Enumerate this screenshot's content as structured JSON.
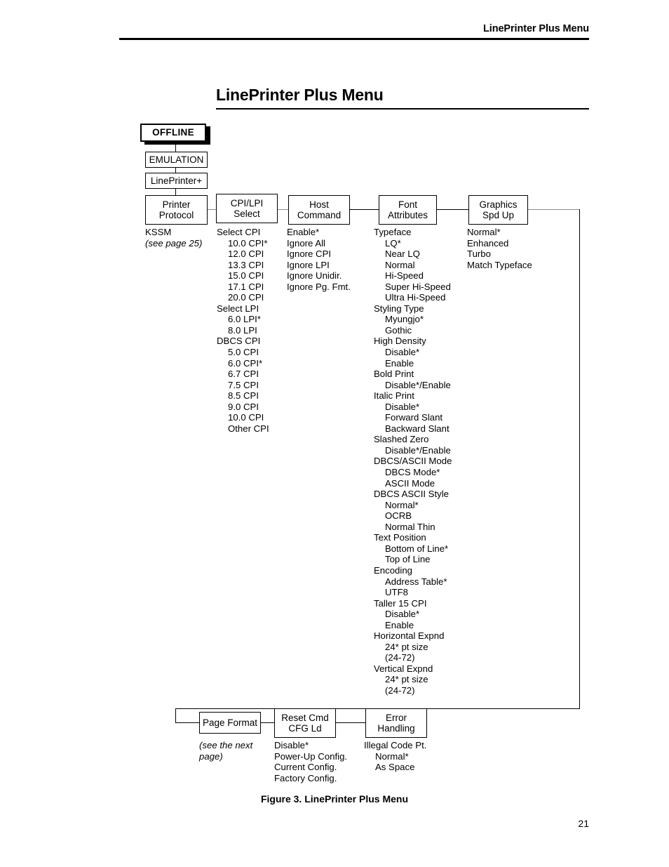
{
  "header": {
    "running_title": "LinePrinter Plus Menu"
  },
  "title": "LinePrinter Plus Menu",
  "caption": "Figure 3. LinePrinter Plus Menu",
  "page_number": "21",
  "diagram": {
    "offline_box": "OFFLINE",
    "emulation_box": "EMULATION",
    "lineprinter_box": "LinePrinter+",
    "columns": [
      {
        "box_line1": "Printer",
        "box_line2": "Protocol",
        "options": [
          {
            "text": "KSSM",
            "level": 0,
            "style": "normal"
          },
          {
            "text": "(see page 25)",
            "level": 0,
            "style": "italic"
          }
        ]
      },
      {
        "box_line1": "CPI/LPI Select",
        "box_line2": "",
        "options": [
          {
            "text": "Select CPI",
            "level": 0,
            "style": "normal"
          },
          {
            "text": "10.0 CPI*",
            "level": 1,
            "style": "normal"
          },
          {
            "text": "12.0 CPI",
            "level": 1,
            "style": "normal"
          },
          {
            "text": "13.3 CPI",
            "level": 1,
            "style": "normal"
          },
          {
            "text": "15.0 CPI",
            "level": 1,
            "style": "normal"
          },
          {
            "text": "17.1 CPI",
            "level": 1,
            "style": "normal"
          },
          {
            "text": "20.0 CPI",
            "level": 1,
            "style": "normal"
          },
          {
            "text": "Select LPI",
            "level": 0,
            "style": "normal"
          },
          {
            "text": "6.0 LPI*",
            "level": 1,
            "style": "normal"
          },
          {
            "text": "8.0 LPI",
            "level": 1,
            "style": "normal"
          },
          {
            "text": "DBCS CPI",
            "level": 0,
            "style": "normal"
          },
          {
            "text": "5.0 CPI",
            "level": 1,
            "style": "normal"
          },
          {
            "text": "6.0 CPI*",
            "level": 1,
            "style": "normal"
          },
          {
            "text": "6.7 CPI",
            "level": 1,
            "style": "normal"
          },
          {
            "text": "7.5 CPI",
            "level": 1,
            "style": "normal"
          },
          {
            "text": "8.5 CPI",
            "level": 1,
            "style": "normal"
          },
          {
            "text": "9.0 CPI",
            "level": 1,
            "style": "normal"
          },
          {
            "text": "10.0 CPI",
            "level": 1,
            "style": "normal"
          },
          {
            "text": "Other CPI",
            "level": 1,
            "style": "normal"
          }
        ]
      },
      {
        "box_line1": "Host",
        "box_line2": "Command",
        "options": [
          {
            "text": "Enable*",
            "level": 0,
            "style": "normal"
          },
          {
            "text": "Ignore All",
            "level": 0,
            "style": "normal"
          },
          {
            "text": "Ignore CPI",
            "level": 0,
            "style": "normal"
          },
          {
            "text": "Ignore LPI",
            "level": 0,
            "style": "normal"
          },
          {
            "text": "Ignore Unidir.",
            "level": 0,
            "style": "normal"
          },
          {
            "text": "Ignore Pg. Fmt.",
            "level": 0,
            "style": "normal"
          }
        ]
      },
      {
        "box_line1": "Font",
        "box_line2": "Attributes",
        "options": [
          {
            "text": "Typeface",
            "level": 0,
            "style": "normal"
          },
          {
            "text": "LQ*",
            "level": 1,
            "style": "normal"
          },
          {
            "text": "Near LQ",
            "level": 1,
            "style": "normal"
          },
          {
            "text": "Normal",
            "level": 1,
            "style": "normal"
          },
          {
            "text": "Hi-Speed",
            "level": 1,
            "style": "normal"
          },
          {
            "text": "Super Hi-Speed",
            "level": 1,
            "style": "normal"
          },
          {
            "text": "Ultra Hi-Speed",
            "level": 1,
            "style": "normal"
          },
          {
            "text": "Styling Type",
            "level": 0,
            "style": "normal"
          },
          {
            "text": "Myungjo*",
            "level": 1,
            "style": "normal"
          },
          {
            "text": "Gothic",
            "level": 1,
            "style": "normal"
          },
          {
            "text": "High Density",
            "level": 0,
            "style": "normal"
          },
          {
            "text": "Disable*",
            "level": 1,
            "style": "normal"
          },
          {
            "text": "Enable",
            "level": 1,
            "style": "normal"
          },
          {
            "text": "Bold Print",
            "level": 0,
            "style": "normal"
          },
          {
            "text": "Disable*/Enable",
            "level": 1,
            "style": "normal"
          },
          {
            "text": "Italic Print",
            "level": 0,
            "style": "normal"
          },
          {
            "text": "Disable*",
            "level": 1,
            "style": "normal"
          },
          {
            "text": "Forward Slant",
            "level": 1,
            "style": "normal"
          },
          {
            "text": "Backward Slant",
            "level": 1,
            "style": "normal"
          },
          {
            "text": "Slashed Zero",
            "level": 0,
            "style": "normal"
          },
          {
            "text": "Disable*/Enable",
            "level": 1,
            "style": "normal"
          },
          {
            "text": "DBCS/ASCII Mode",
            "level": 0,
            "style": "normal"
          },
          {
            "text": "DBCS Mode*",
            "level": 1,
            "style": "normal"
          },
          {
            "text": "ASCII Mode",
            "level": 1,
            "style": "normal"
          },
          {
            "text": "DBCS ASCII Style",
            "level": 0,
            "style": "normal"
          },
          {
            "text": "Normal*",
            "level": 1,
            "style": "normal"
          },
          {
            "text": "OCRB",
            "level": 1,
            "style": "normal"
          },
          {
            "text": "Normal Thin",
            "level": 1,
            "style": "normal"
          },
          {
            "text": "Text Position",
            "level": 0,
            "style": "normal"
          },
          {
            "text": "Bottom of Line*",
            "level": 1,
            "style": "normal"
          },
          {
            "text": "Top of Line",
            "level": 1,
            "style": "normal"
          },
          {
            "text": "Encoding",
            "level": 0,
            "style": "normal"
          },
          {
            "text": "Address Table*",
            "level": 1,
            "style": "normal"
          },
          {
            "text": "UTF8",
            "level": 1,
            "style": "normal"
          },
          {
            "text": "Taller 15 CPI",
            "level": 0,
            "style": "normal"
          },
          {
            "text": "Disable*",
            "level": 1,
            "style": "normal"
          },
          {
            "text": "Enable",
            "level": 1,
            "style": "normal"
          },
          {
            "text": "Horizontal Expnd",
            "level": 0,
            "style": "normal"
          },
          {
            "text": "24* pt size",
            "level": 1,
            "style": "normal"
          },
          {
            "text": "(24-72)",
            "level": 1,
            "style": "normal"
          },
          {
            "text": "Vertical Expnd",
            "level": 0,
            "style": "normal"
          },
          {
            "text": "24* pt size",
            "level": 1,
            "style": "normal"
          },
          {
            "text": "(24-72)",
            "level": 1,
            "style": "normal"
          }
        ]
      },
      {
        "box_line1": "Graphics",
        "box_line2": "Spd Up",
        "options": [
          {
            "text": "Normal*",
            "level": 0,
            "style": "normal"
          },
          {
            "text": "Enhanced",
            "level": 0,
            "style": "normal"
          },
          {
            "text": "Turbo",
            "level": 0,
            "style": "normal"
          },
          {
            "text": "Match Typeface",
            "level": 0,
            "style": "normal"
          }
        ]
      }
    ],
    "bottom_columns": [
      {
        "box_line1": "Page Format",
        "box_line2": "",
        "options": [
          {
            "text": "(see the next page)",
            "level": 0,
            "style": "italic-block"
          }
        ]
      },
      {
        "box_line1": "Reset Cmd",
        "box_line2": "CFG Ld",
        "options": [
          {
            "text": "Disable*",
            "level": 0,
            "style": "normal"
          },
          {
            "text": "Power-Up Config.",
            "level": 0,
            "style": "normal"
          },
          {
            "text": "Current Config.",
            "level": 0,
            "style": "normal"
          },
          {
            "text": "Factory Config.",
            "level": 0,
            "style": "normal"
          }
        ]
      },
      {
        "box_line1": "Error",
        "box_line2": "Handling",
        "options": [
          {
            "text": "Illegal Code Pt.",
            "level": 0,
            "style": "normal"
          },
          {
            "text": "Normal*",
            "level": 1,
            "style": "normal"
          },
          {
            "text": "As Space",
            "level": 1,
            "style": "normal"
          }
        ]
      }
    ]
  }
}
